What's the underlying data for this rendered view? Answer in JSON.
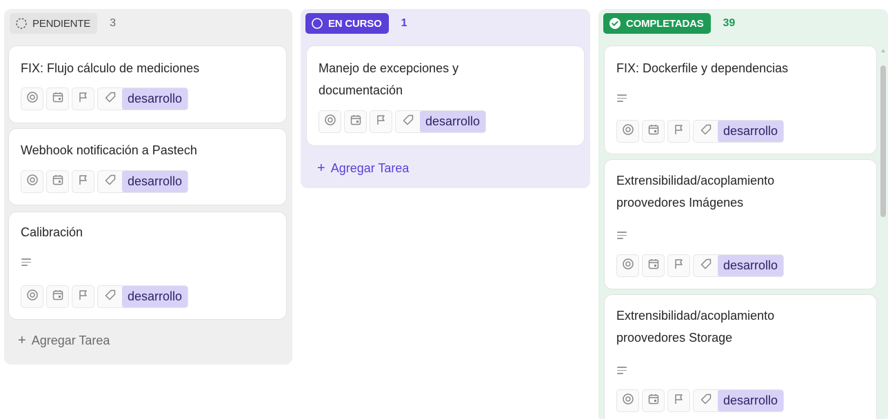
{
  "columns": {
    "pending": {
      "label": "PENDIENTE",
      "count": "3",
      "add_label": "Agregar Tarea",
      "cards": [
        {
          "title": "FIX: Flujo cálculo de mediciones",
          "tag": "desarrollo"
        },
        {
          "title": "Webhook notificación a Pastech",
          "tag": "desarrollo"
        },
        {
          "title": "Calibración",
          "tag": "desarrollo"
        }
      ]
    },
    "in_progress": {
      "label": "EN CURSO",
      "count": "1",
      "add_label": "Agregar Tarea",
      "cards": [
        {
          "title_line1": "Manejo de excepciones y",
          "title_line2": "documentación",
          "tag": "desarrollo"
        }
      ]
    },
    "completed": {
      "label": "COMPLETADAS",
      "count": "39",
      "cards": [
        {
          "title": "FIX: Dockerfile y dependencias",
          "tag": "desarrollo"
        },
        {
          "title_line1": "Extrensibilidad/acoplamiento",
          "title_line2": "proovedores Imágenes",
          "tag": "desarrollo"
        },
        {
          "title_line1": "Extrensibilidad/acoplamiento",
          "title_line2": "proovedores Storage",
          "tag": "desarrollo"
        }
      ]
    }
  },
  "plus_symbol": "+",
  "colors": {
    "in_progress_accent": "#5b3fd9",
    "completed_accent": "#1f9a55",
    "tag_background": "#d9d2f7"
  },
  "icons": [
    "dashed-circle-icon",
    "circle-icon",
    "check-circle-icon",
    "at-sign-icon",
    "calendar-icon",
    "flag-icon",
    "tag-icon",
    "description-icon",
    "plus-icon"
  ]
}
